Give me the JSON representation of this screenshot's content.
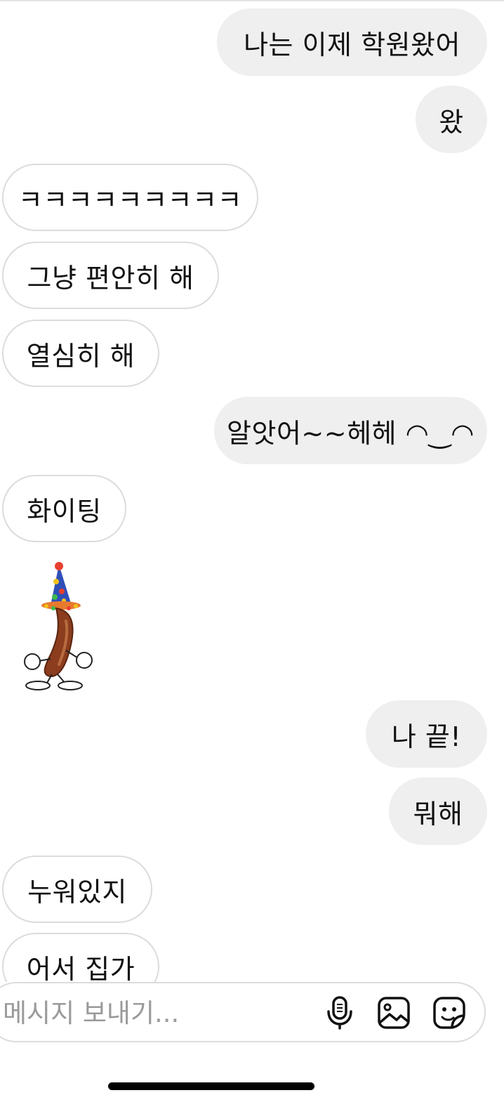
{
  "messages": [
    {
      "direction": "sent",
      "text": "나는 이제 학원왔어"
    },
    {
      "direction": "sent",
      "text": "왔"
    },
    {
      "direction": "received",
      "text": "ㅋㅋㅋㅋㅋㅋㅋㅋㅋ"
    },
    {
      "direction": "received",
      "text": "그냥 편안히 해"
    },
    {
      "direction": "received",
      "text": "열심히 해"
    },
    {
      "direction": "sent",
      "text": "알앗어~~헤헤 ◠‿◠"
    },
    {
      "direction": "received",
      "text": "화이팅"
    },
    {
      "direction": "received",
      "type": "sticker",
      "sticker": "sausage-party-hat-sticker"
    },
    {
      "direction": "sent",
      "text": "나 끝!"
    },
    {
      "direction": "sent",
      "text": "뭐해"
    },
    {
      "direction": "received",
      "text": "누워있지"
    },
    {
      "direction": "received",
      "text": "어서 집가"
    }
  ],
  "composer": {
    "placeholder": "메시지 보내기...",
    "icons": [
      "microphone-icon",
      "image-icon",
      "sticker-icon"
    ]
  },
  "colors": {
    "sent_bubble": "#efefef",
    "received_border": "#dcdcdc",
    "placeholder": "#9a9a9a"
  }
}
